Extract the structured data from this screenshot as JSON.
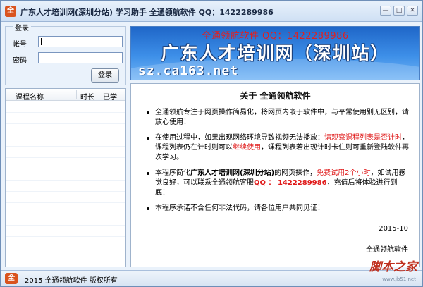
{
  "window": {
    "icon_char": "全",
    "title": "广东人才培训网(深圳分站)  学习助手  全通领航软件  QQ：1422289986",
    "btn_min": "—",
    "btn_max": "□",
    "btn_close": "✕"
  },
  "login": {
    "group_label": "登录",
    "account_label": "帐号",
    "password_label": "密码",
    "account_value": "",
    "password_value": "",
    "login_button": "登录"
  },
  "course_list": {
    "columns": [
      "课程名称",
      "时长",
      "已学"
    ],
    "rows": []
  },
  "banner": {
    "watermark": "全通领航软件 QQ：1422289986",
    "title": "广东人才培训网（深圳站）",
    "url": "sz.ca163.net",
    "bg_color": "#2f7be0"
  },
  "content": {
    "title": "关于  全通领航软件",
    "p1": "全通领航专注于网页操作简易化，将网页内嵌于软件中，与平常使用别无区别，请放心使用！",
    "p2_a": "在使用过程中，如果出现网络环境导致视频无法播放：",
    "p2_b": "请观察课程列表是否计时",
    "p2_c": "，课程列表仍在计时则可以",
    "p2_d": "继续使用",
    "p2_e": "，课程列表若出现计时卡住则可重新登陆软件再次学习。",
    "p3_a": "本程序简化",
    "p3_b": "广东人才培训网(深圳分站)",
    "p3_c": "的网页操作，",
    "p3_d": "免费试用2个小时",
    "p3_e": "，如试用感觉良好，可以联系全通领航客服",
    "p3_f": "QQ ： 1422289986",
    "p3_g": "，充值后将体验进行到底！",
    "p4": "本程序承诺不含任何非法代码，请各位用户共同见证！",
    "date": "2015-10",
    "signature": "全通领航软件",
    "highlight_color": "#e01b1b"
  },
  "statusbar": {
    "icon_char": "全",
    "text": "2015  全通领航软件  版权所有"
  },
  "watermark_site": {
    "text": "脚本之家",
    "sub": "www.jb51.net"
  }
}
